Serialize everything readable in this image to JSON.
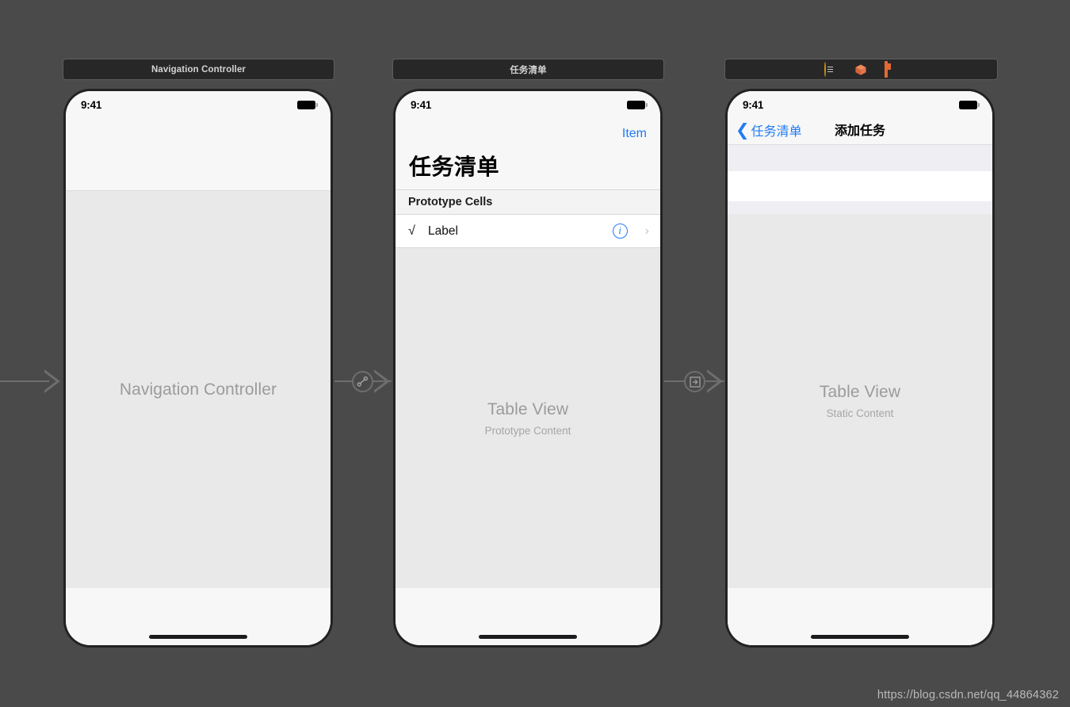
{
  "canvas": {
    "background_color": "#4a4a4a",
    "watermark": "https://blog.csdn.net/qq_44864362"
  },
  "scenes": [
    {
      "id": "navigation-controller-scene",
      "dock_label": "Navigation Controller",
      "dock_icons": [],
      "status_bar": {
        "time": "9:41",
        "battery": "battery-full-icon"
      },
      "placeholder_title": "Navigation Controller",
      "placeholder_subtitle": ""
    },
    {
      "id": "task-list-scene",
      "dock_label": "任务清单",
      "dock_icons": [],
      "status_bar": {
        "time": "9:41",
        "battery": "battery-full-icon"
      },
      "nav_right_button": "Item",
      "large_title": "任务清单",
      "section_header": "Prototype Cells",
      "cell": {
        "glyph": "√",
        "label": "Label",
        "accessory_info": "i",
        "accessory_chevron": "›"
      },
      "placeholder_title": "Table View",
      "placeholder_subtitle": "Prototype Content"
    },
    {
      "id": "add-task-scene",
      "dock_label": "",
      "dock_icons": [
        {
          "name": "view-controller-icon",
          "color": "#f6c23c"
        },
        {
          "name": "first-responder-cube-icon",
          "color": "#e06a32"
        },
        {
          "name": "exit-icon",
          "color": "#e06a32"
        }
      ],
      "status_bar": {
        "time": "9:41",
        "battery": "battery-full-icon"
      },
      "back_button": "任务清单",
      "back_chevron": "❮",
      "nav_title": "添加任务",
      "placeholder_title": "Table View",
      "placeholder_subtitle": "Static Content"
    }
  ],
  "segues": [
    {
      "name": "entry-point-arrow",
      "kind": "initial-view-controller",
      "badge": null
    },
    {
      "name": "relationship-segue",
      "kind": "root-view-controller",
      "badge": "relationship-icon"
    },
    {
      "name": "show-segue",
      "kind": "show",
      "badge": "show-segue-icon"
    }
  ]
}
